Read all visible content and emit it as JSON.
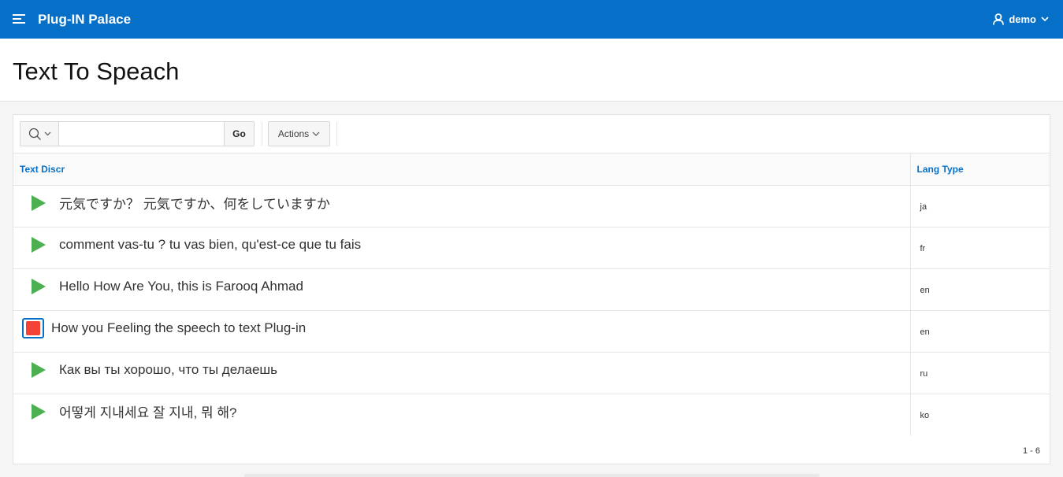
{
  "app": {
    "title": "Plug-IN Palace",
    "user": "demo"
  },
  "page": {
    "title": "Text To Speach"
  },
  "toolbar": {
    "go_label": "Go",
    "actions_label": "Actions",
    "search_value": ""
  },
  "columns": {
    "text": "Text Discr",
    "lang": "Lang Type"
  },
  "rows": [
    {
      "text": "元気ですか？ 元気ですか、何をしていますか",
      "lang": "ja",
      "state": "play"
    },
    {
      "text": "comment vas-tu ? tu vas bien, qu'est-ce que tu fais",
      "lang": "fr",
      "state": "play"
    },
    {
      "text": "Hello How Are You, this is Farooq Ahmad",
      "lang": "en",
      "state": "play"
    },
    {
      "text": "How you Feeling the speech to text Plug-in",
      "lang": "en",
      "state": "stop"
    },
    {
      "text": "Как вы ты хорошо, что ты делаешь",
      "lang": "ru",
      "state": "play"
    },
    {
      "text": "어떻게 지내세요 잘 지내, 뭐 해?",
      "lang": "ko",
      "state": "play"
    }
  ],
  "pagination": {
    "range": "1 - 6"
  },
  "colors": {
    "brand": "#0670c9",
    "play": "#4caf50",
    "stop": "#f44336"
  }
}
